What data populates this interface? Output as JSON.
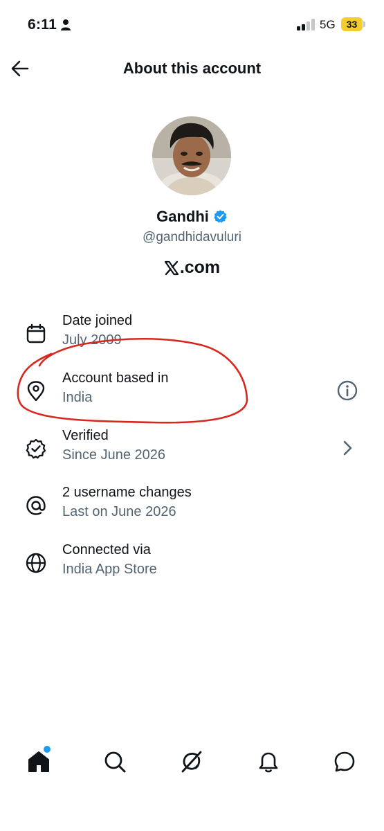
{
  "status_bar": {
    "time": "6:11",
    "network": "5G",
    "battery": "33"
  },
  "header": {
    "title": "About this account",
    "back_icon": "arrow-left-icon"
  },
  "profile": {
    "name": "Gandhi",
    "handle": "@gandhidavuluri",
    "domain_suffix": ".com",
    "domain_logo": "x-logo-icon",
    "verified_color": "#1d9bf0"
  },
  "info_items": [
    {
      "icon": "calendar-icon",
      "title": "Date joined",
      "value": "July 2009"
    },
    {
      "icon": "location-pin-icon",
      "title": "Account based in",
      "value": "India",
      "trailing_icon": "info-icon"
    },
    {
      "icon": "verified-badge-icon",
      "title": "Verified",
      "value": "Since June 2026",
      "trailing_icon": "chevron-right-icon"
    },
    {
      "icon": "at-sign-icon",
      "title": "2 username changes",
      "value": "Last on June 2026"
    },
    {
      "icon": "globe-icon",
      "title": "Connected via",
      "value": "India App Store"
    }
  ],
  "tab_bar": [
    {
      "name": "Home",
      "icon": "home-icon",
      "active": true,
      "has_notification_dot": true
    },
    {
      "name": "Search",
      "icon": "search-icon"
    },
    {
      "name": "Grok",
      "icon": "grok-icon"
    },
    {
      "name": "Notifications",
      "icon": "bell-icon"
    },
    {
      "name": "Messages",
      "icon": "message-icon"
    }
  ],
  "colors": {
    "text_primary": "#0f1419",
    "text_secondary": "#536471",
    "accent": "#1d9bf0",
    "annotation_red": "#d6281f",
    "battery": "#f3cc2f"
  }
}
